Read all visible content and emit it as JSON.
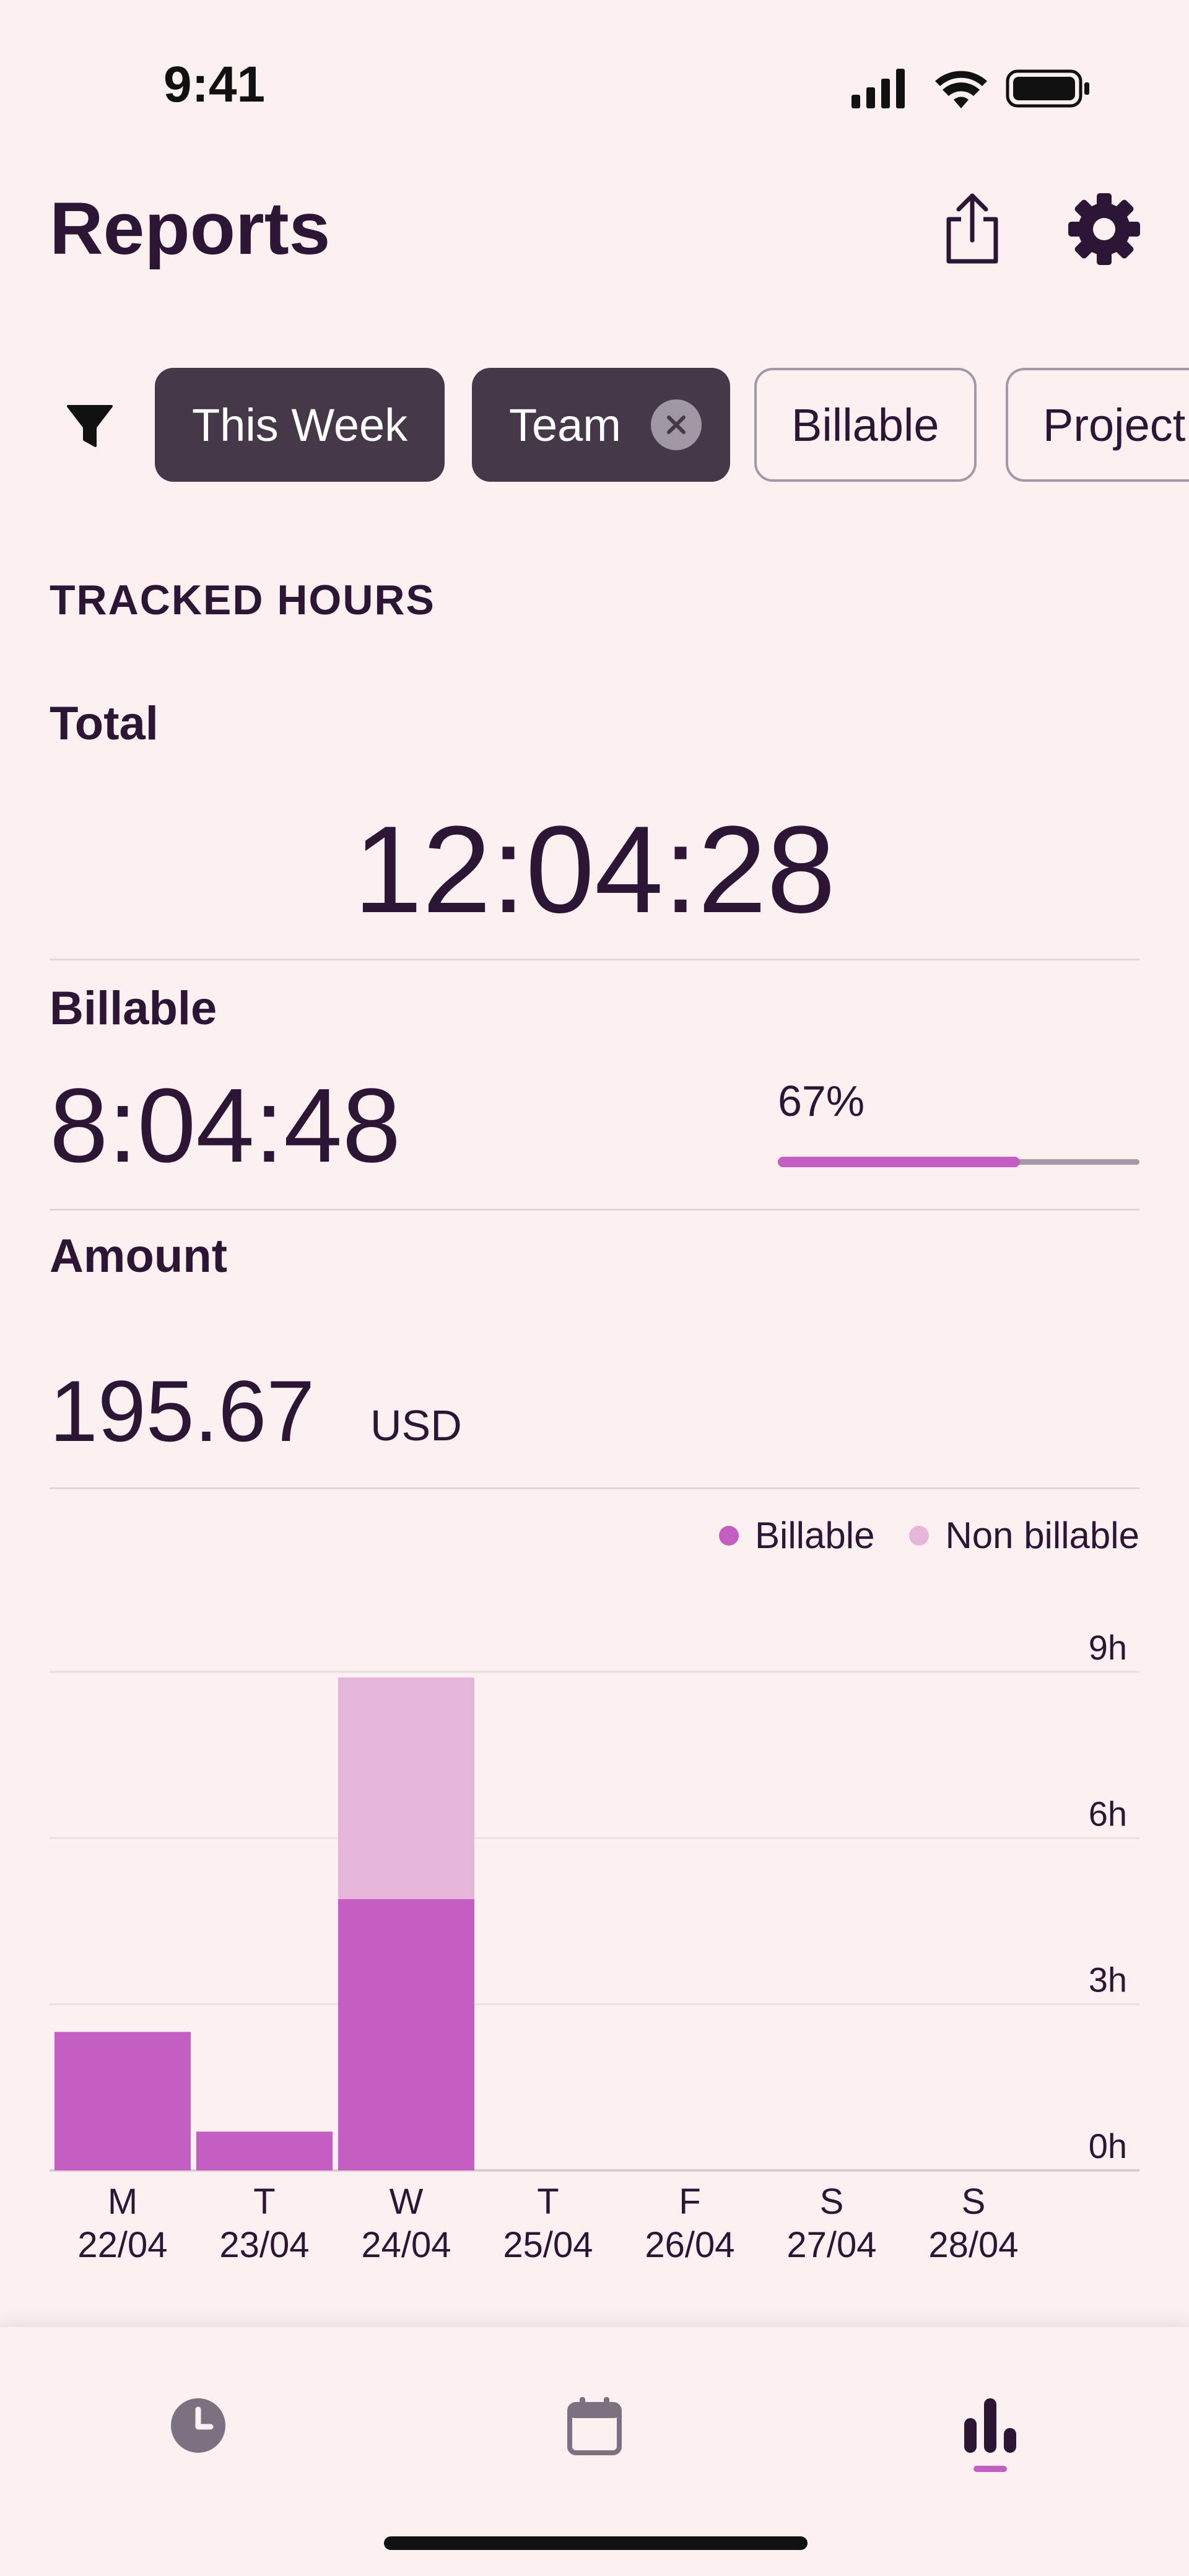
{
  "status_bar": {
    "time": "9:41"
  },
  "header": {
    "title": "Reports",
    "share_icon": "share-icon",
    "settings_icon": "gear-icon"
  },
  "filters": {
    "icon": "filter-icon",
    "chips": [
      {
        "label": "This Week",
        "active": true
      },
      {
        "label": "Team",
        "active": true,
        "removable": true
      },
      {
        "label": "Billable",
        "active": false
      },
      {
        "label": "Project",
        "active": false
      }
    ]
  },
  "tracked": {
    "section_title": "TRACKED HOURS",
    "total_label": "Total",
    "total_value": "12:04:28",
    "billable_label": "Billable",
    "billable_value": "8:04:48",
    "billable_percent_text": "67%",
    "billable_fraction": 0.67,
    "amount_label": "Amount",
    "amount_value": "195.67",
    "amount_currency": "USD"
  },
  "colors": {
    "billable": "#c55ec2",
    "non_billable": "#e5b6da",
    "text": "#2c1535",
    "background": "#fcf1f0"
  },
  "chart_data": {
    "type": "bar",
    "stacked": true,
    "legend": [
      "Billable",
      "Non billable"
    ],
    "legend_position": "top-right",
    "categories": [
      {
        "day": "M",
        "date": "22/04"
      },
      {
        "day": "T",
        "date": "23/04"
      },
      {
        "day": "W",
        "date": "24/04"
      },
      {
        "day": "T",
        "date": "25/04"
      },
      {
        "day": "F",
        "date": "26/04"
      },
      {
        "day": "S",
        "date": "27/04"
      },
      {
        "day": "S",
        "date": "28/04"
      }
    ],
    "series": [
      {
        "name": "Billable",
        "values": [
          2.5,
          0.7,
          4.9,
          0,
          0,
          0,
          0
        ]
      },
      {
        "name": "Non billable",
        "values": [
          0,
          0,
          4.0,
          0,
          0,
          0,
          0
        ]
      }
    ],
    "y_ticks": [
      "0h",
      "3h",
      "6h",
      "9h"
    ],
    "ylim": [
      0,
      9
    ],
    "y_axis_side": "right",
    "grid": true
  },
  "tabbar": {
    "items": [
      "clock-icon",
      "calendar-icon",
      "reports-icon"
    ],
    "selected": 2
  }
}
